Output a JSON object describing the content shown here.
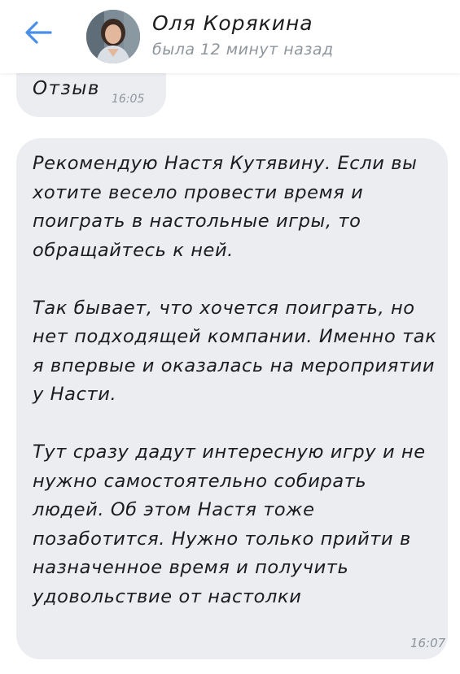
{
  "header": {
    "contact_name": "Оля Корякина",
    "status": "была 12 минут назад",
    "back_icon": "arrow-left-icon",
    "accent_color": "#4a8fe7"
  },
  "messages": [
    {
      "text": "Отзыв",
      "time": "16:05"
    },
    {
      "paragraphs": [
        "Рекомендую Настя Кутявину. Если вы хотите весело провести время и поиграть в настольные игры, то обращайтесь к ней.",
        "Так бывает, что хочется поиграть, но нет подходящей компании. Именно так я впервые и оказалась на мероприятии у Насти.",
        "Тут сразу дадут интересную игру и не нужно самостоятельно собирать людей. Об этом Настя тоже позаботится. Нужно только прийти в назначенное время и получить удовольствие от настолки"
      ],
      "time": "16:07"
    }
  ]
}
